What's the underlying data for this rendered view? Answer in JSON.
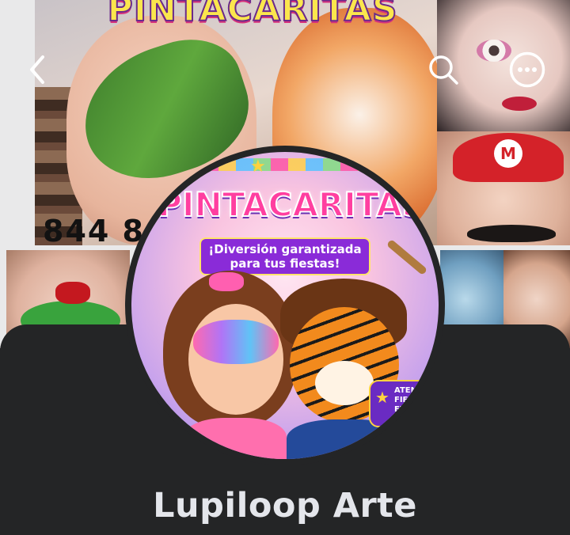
{
  "cover": {
    "banner_title": "PINTACARITAS",
    "phone_partial": "844 8",
    "mario_letter": "M"
  },
  "nav": {
    "back_icon": "chevron-left-icon",
    "search_icon": "search-icon",
    "more_icon": "more-horizontal-icon"
  },
  "avatar": {
    "title": "¡PINTACARITAS!",
    "subtitle_line1": "¡Diversión garantizada",
    "subtitle_line2": "para tus fiestas!",
    "badge_text": "ATENDE FIEST EVE Y..."
  },
  "profile": {
    "name": "Lupiloop Arte"
  },
  "colors": {
    "panel_bg": "#242526",
    "name_text": "#e4e6eb"
  }
}
